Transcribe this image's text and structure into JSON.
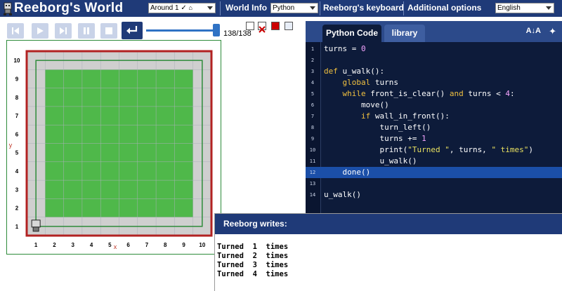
{
  "header": {
    "app_title": "Reeborg's World",
    "world_select": "Around 1 ✓",
    "world_info_label": "World Info",
    "language_select": "Python",
    "keyboard_label": "Reeborg's keyboard",
    "options_label": "Additional options",
    "ui_language_select": "English"
  },
  "controls": {
    "icons": [
      "rewind-icon",
      "play-icon",
      "step-forward-icon",
      "pause-icon",
      "stop-icon",
      "return-icon"
    ],
    "step_counter": "138/138",
    "slider_value": 1.0
  },
  "world": {
    "x_ticks": [
      "1",
      "2",
      "3",
      "4",
      "5",
      "6",
      "7",
      "8",
      "9",
      "10"
    ],
    "y_ticks": [
      "1",
      "2",
      "3",
      "4",
      "5",
      "6",
      "7",
      "8",
      "9",
      "10"
    ],
    "x_axis_label": "x",
    "y_axis_label": "y",
    "colors": {
      "grass": "#4fb84a",
      "pavement": "#cfcfcf",
      "wall": "#b22222",
      "path": "#2e8b3a"
    }
  },
  "editor": {
    "tabs": [
      "Python Code",
      "library"
    ],
    "active_tab": "Python Code",
    "font_size_label": "A↓A",
    "highlighted_line": 12,
    "lines": [
      {
        "n": "1",
        "text": "turns = 0"
      },
      {
        "n": "2",
        "text": ""
      },
      {
        "n": "3",
        "text": "def u_walk():"
      },
      {
        "n": "4",
        "text": "    global turns"
      },
      {
        "n": "5",
        "text": "    while front_is_clear() and turns < 4:"
      },
      {
        "n": "6",
        "text": "        move()"
      },
      {
        "n": "7",
        "text": "        if wall_in_front():"
      },
      {
        "n": "8",
        "text": "            turn_left()"
      },
      {
        "n": "9",
        "text": "            turns += 1"
      },
      {
        "n": "10",
        "text": "            print(\"Turned \", turns, \" times\")"
      },
      {
        "n": "11",
        "text": "            u_walk()"
      },
      {
        "n": "12",
        "text": "    done()"
      },
      {
        "n": "13",
        "text": ""
      },
      {
        "n": "14",
        "text": "u_walk()"
      }
    ]
  },
  "output": {
    "title": "Reeborg writes:",
    "lines": [
      "Turned  1  times",
      "Turned  2  times",
      "Turned  3  times",
      "Turned  4  times"
    ]
  }
}
